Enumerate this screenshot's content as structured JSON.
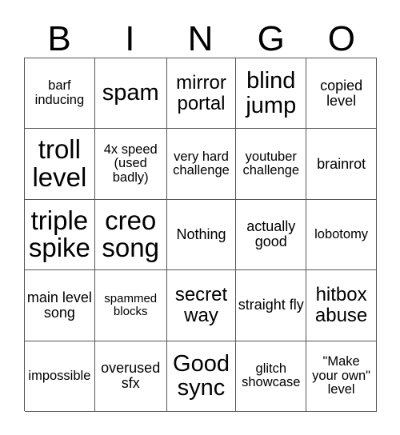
{
  "card": {
    "headers": [
      "B",
      "I",
      "N",
      "G",
      "O"
    ],
    "rows": [
      [
        {
          "text": "barf inducing",
          "size": "sz-s"
        },
        {
          "text": "spam",
          "size": "sz-xl"
        },
        {
          "text": "mirror portal",
          "size": "sz-l"
        },
        {
          "text": "blind jump",
          "size": "sz-xl"
        },
        {
          "text": "copied level",
          "size": "sz-m"
        }
      ],
      [
        {
          "text": "troll level",
          "size": "sz-xxl"
        },
        {
          "text": "4x speed (used badly)",
          "size": "sz-s"
        },
        {
          "text": "very hard challenge",
          "size": "sz-s"
        },
        {
          "text": "youtuber challenge",
          "size": "sz-s"
        },
        {
          "text": "brainrot",
          "size": "sz-m"
        }
      ],
      [
        {
          "text": "triple spike",
          "size": "sz-xxl"
        },
        {
          "text": "creo song",
          "size": "sz-xxl"
        },
        {
          "text": "Nothing",
          "size": "sz-m"
        },
        {
          "text": "actually good",
          "size": "sz-m"
        },
        {
          "text": "lobotomy",
          "size": "sz-s"
        }
      ],
      [
        {
          "text": "main level song",
          "size": "sz-m"
        },
        {
          "text": "spammed blocks",
          "size": "sz-xs"
        },
        {
          "text": "secret way",
          "size": "sz-l"
        },
        {
          "text": "straight fly",
          "size": "sz-m"
        },
        {
          "text": "hitbox abuse",
          "size": "sz-l"
        }
      ],
      [
        {
          "text": "impossible",
          "size": "sz-s"
        },
        {
          "text": "overused sfx",
          "size": "sz-m"
        },
        {
          "text": "Good sync",
          "size": "sz-xl"
        },
        {
          "text": "glitch showcase",
          "size": "sz-s"
        },
        {
          "text": "\"Make your own\" level",
          "size": "sz-s"
        }
      ]
    ]
  },
  "colors": {
    "background": "#ffffff",
    "text": "#000000",
    "border": "#555555"
  }
}
